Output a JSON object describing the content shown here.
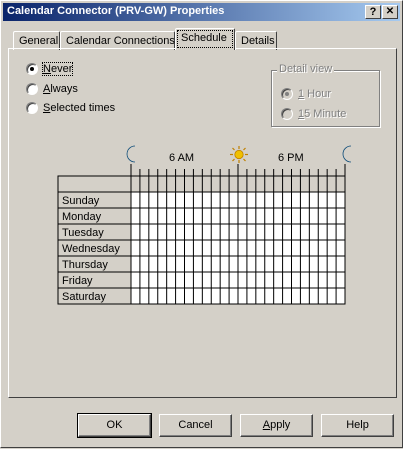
{
  "window": {
    "title": "Calendar Connector (PRV-GW) Properties",
    "help_button": "?",
    "close_button": "✕"
  },
  "tabs": [
    {
      "label": "General",
      "active": false
    },
    {
      "label": "Calendar Connections",
      "active": false
    },
    {
      "label": "Schedule",
      "active": true
    },
    {
      "label": "Details",
      "active": false
    }
  ],
  "schedule_options": {
    "selected": "Never",
    "options": [
      {
        "label_u": "N",
        "label_rest": "ever"
      },
      {
        "label_u": "A",
        "label_rest": "lways"
      },
      {
        "label_u": "S",
        "label_rest": "elected times"
      }
    ]
  },
  "detail_view": {
    "label": "Detail view",
    "selected": "1 Hour",
    "enabled": false,
    "options": [
      {
        "label_u": "1",
        "label_rest": " Hour"
      },
      {
        "label_u": "1",
        "label_rest": "5 Minute"
      }
    ]
  },
  "grid": {
    "time_labels": [
      "6 AM",
      "6 PM"
    ],
    "icons": [
      "moon-icon",
      "sun-icon",
      "moon-icon"
    ],
    "days": [
      "Sunday",
      "Monday",
      "Tuesday",
      "Wednesday",
      "Thursday",
      "Friday",
      "Saturday"
    ],
    "columns": 24
  },
  "buttons": {
    "ok": "OK",
    "cancel": "Cancel",
    "apply_u": "A",
    "apply_rest": "pply",
    "help": "Help"
  },
  "colors": {
    "title_start": "#0a246a",
    "title_end": "#a6caf0",
    "moon": "#1a7ab8",
    "sun": "#f0c000"
  }
}
